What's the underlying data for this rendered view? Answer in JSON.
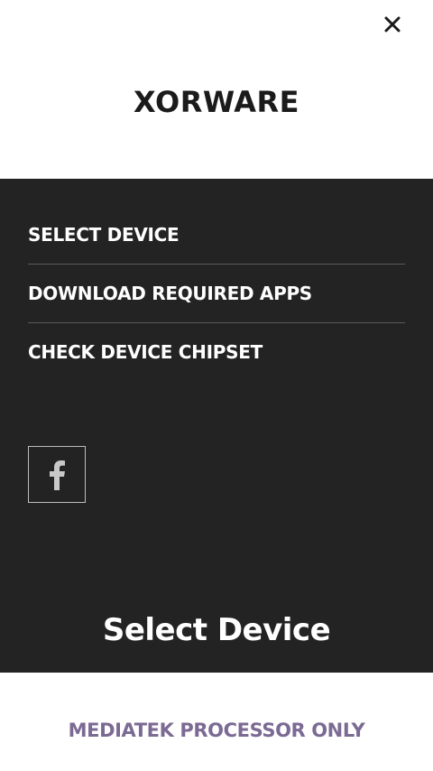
{
  "header": {
    "close_icon": "close-icon",
    "brand": "XORWARE"
  },
  "menu": {
    "items": [
      {
        "label": "SELECT DEVICE"
      },
      {
        "label": "DOWNLOAD REQUIRED APPS"
      },
      {
        "label": "CHECK DEVICE CHIPSET"
      }
    ],
    "social_icon": "facebook-icon"
  },
  "section": {
    "title": "Select Device"
  },
  "footer": {
    "note": "MEDIATEK PROCESSOR ONLY"
  },
  "colors": {
    "panel_bg": "#232323",
    "accent_text": "#7b6a93",
    "brand_text": "#1b1b1b"
  }
}
